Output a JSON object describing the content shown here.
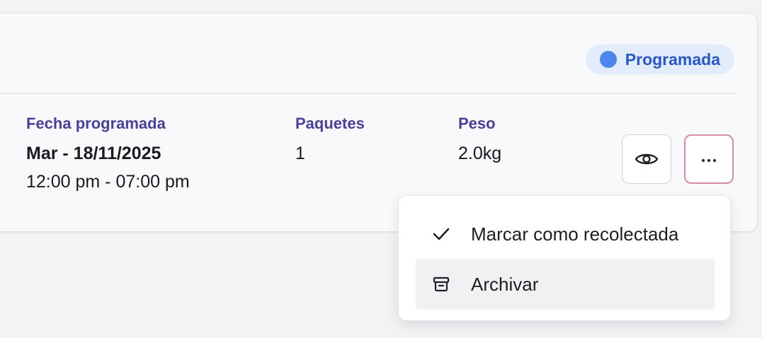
{
  "status": {
    "label": "Programada",
    "color": "#4f86ee"
  },
  "fields": {
    "date_label": "Fecha programada",
    "date_value": "Mar - 18/11/2025",
    "time_range": "12:00 pm - 07:00 pm",
    "packages_label": "Paquetes",
    "packages_value": "1",
    "weight_label": "Peso",
    "weight_value": "2.0kg"
  },
  "actions": {
    "view_icon": "eye-icon",
    "more_icon": "ellipsis-icon"
  },
  "menu": {
    "items": [
      {
        "label": "Marcar como recolectada",
        "icon": "check-icon"
      },
      {
        "label": "Archivar",
        "icon": "archive-icon"
      }
    ]
  }
}
